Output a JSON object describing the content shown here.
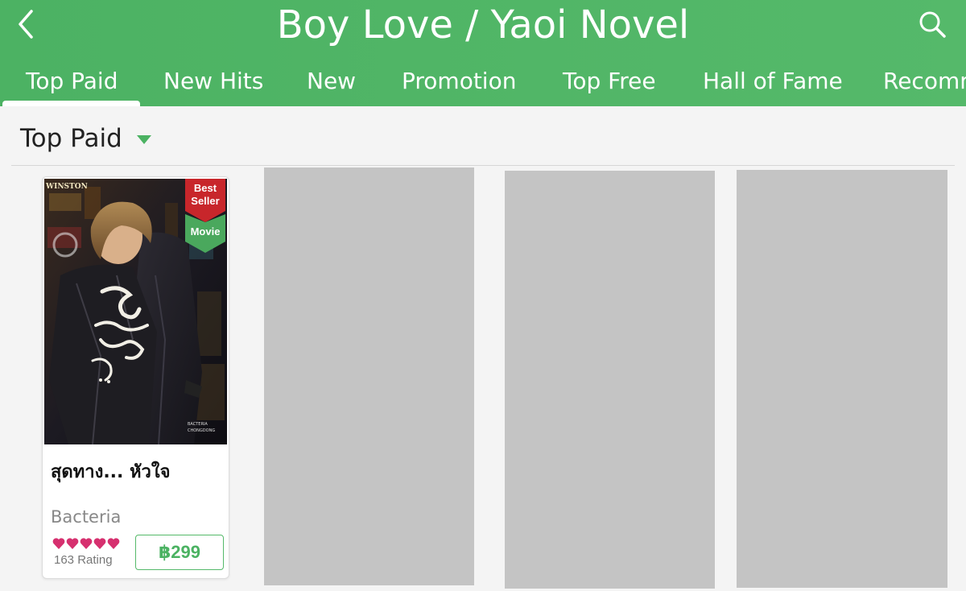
{
  "header": {
    "title": "Boy Love / Yaoi Novel",
    "background": "#52b767"
  },
  "tabs": [
    {
      "label": "Top Paid",
      "active": true
    },
    {
      "label": "New Hits"
    },
    {
      "label": "New"
    },
    {
      "label": "Promotion"
    },
    {
      "label": "Top Free"
    },
    {
      "label": "Hall of Fame"
    },
    {
      "label": "Recomm"
    }
  ],
  "section": {
    "title": "Top Paid"
  },
  "books": [
    {
      "title": "สุดทาง... หัวใจ",
      "author": "Bacteria",
      "rating_hearts": 5,
      "rating_label": "163 Rating",
      "price": "฿299",
      "badges": [
        "Best Seller",
        "Movie"
      ],
      "cover_text": {
        "brand": "WINSTON",
        "credits_1": "BACTERIA",
        "credits_2": "CHONGDONG"
      }
    }
  ],
  "colors": {
    "accent": "#4bb262",
    "badge_red": "#c8262b",
    "badge_green": "#4aa85d",
    "heart": "#d6306f",
    "placeholder": "#c4c4c4"
  }
}
